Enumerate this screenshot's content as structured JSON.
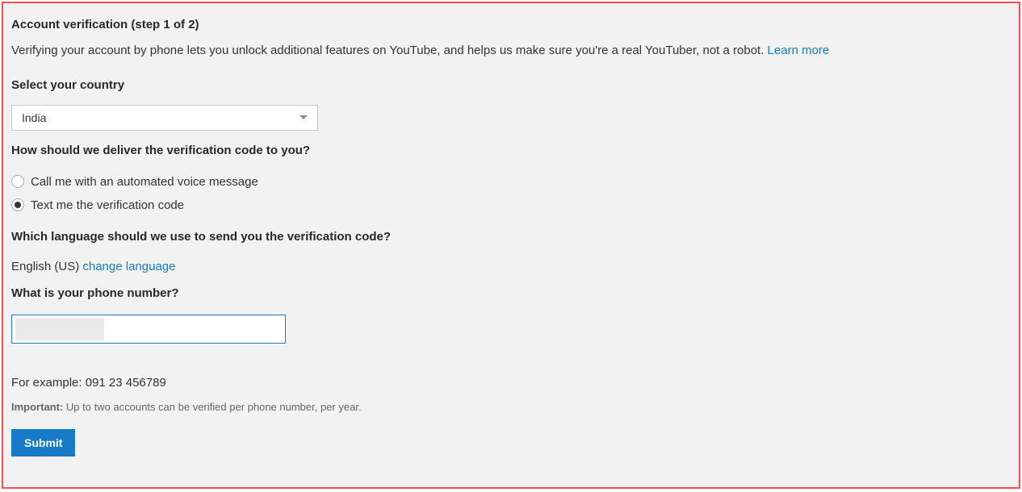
{
  "header": {
    "title": "Account verification (step 1 of 2)",
    "description": "Verifying your account by phone lets you unlock additional features on YouTube, and helps us make sure you're a real YouTuber, not a robot. ",
    "learn_more": "Learn more"
  },
  "country": {
    "label": "Select your country",
    "selected": "India"
  },
  "delivery": {
    "label": "How should we deliver the verification code to you?",
    "options": [
      {
        "label": "Call me with an automated voice message",
        "selected": false
      },
      {
        "label": "Text me the verification code",
        "selected": true
      }
    ]
  },
  "language": {
    "label": "Which language should we use to send you the verification code?",
    "current": "English (US) ",
    "change_link": "change language"
  },
  "phone": {
    "label": "What is your phone number?",
    "value": "",
    "example": "For example: 091 23 456789"
  },
  "important": {
    "label": "Important: ",
    "text": "Up to two accounts can be verified per phone number, per year."
  },
  "submit": {
    "label": "Submit"
  }
}
